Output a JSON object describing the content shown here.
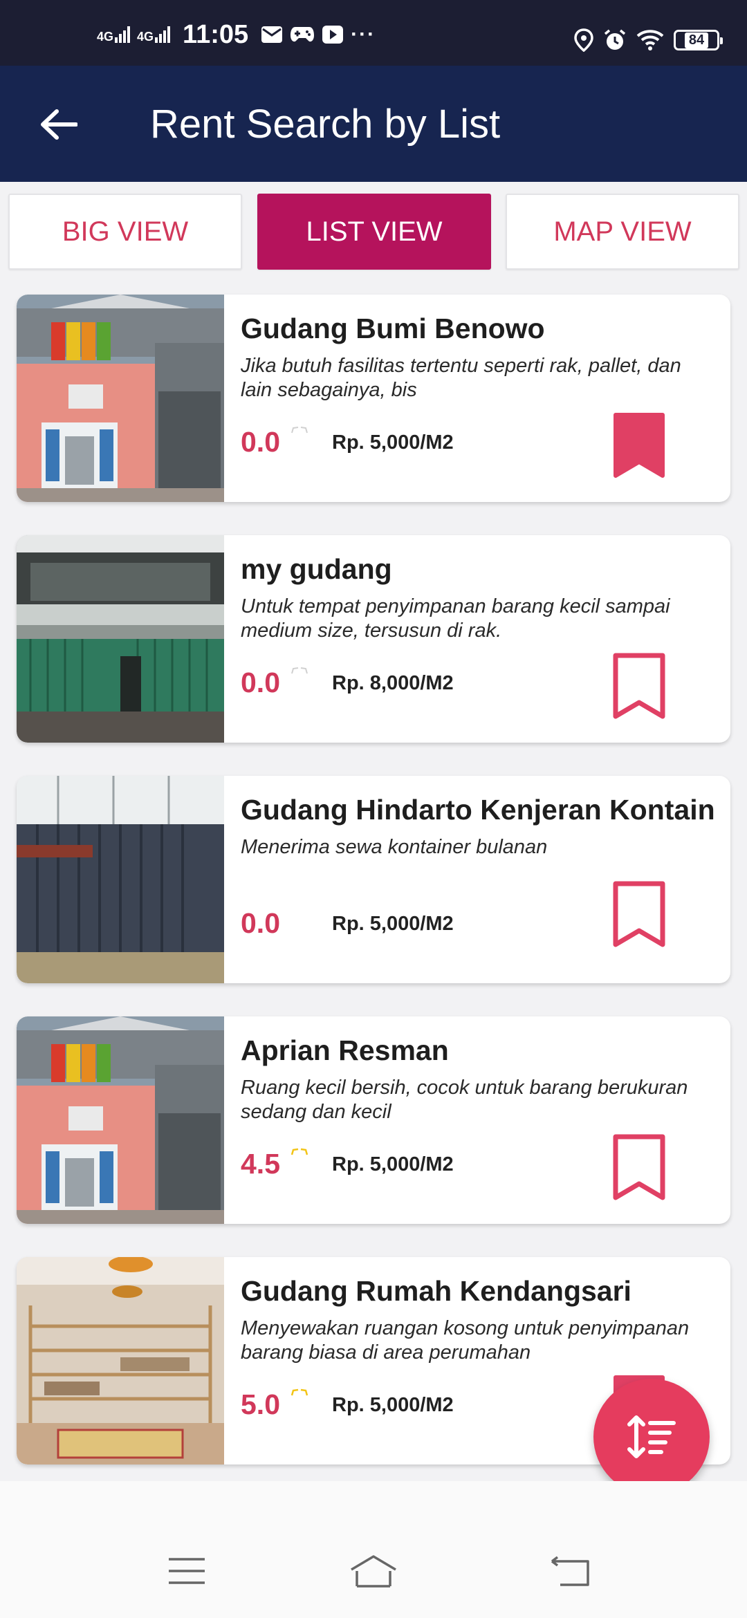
{
  "status_bar": {
    "time": "11:05",
    "network_1": "4G",
    "network_2": "4G",
    "more": "···",
    "battery": "84"
  },
  "header": {
    "title": "Rent Search by List"
  },
  "tabs": [
    {
      "label": "BIG VIEW",
      "active": false
    },
    {
      "label": "LIST VIEW",
      "active": true
    },
    {
      "label": "MAP VIEW",
      "active": false
    }
  ],
  "listings": [
    {
      "title": "Gudang Bumi Benowo",
      "description": "Jika butuh fasilitas tertentu seperti rak, pallet, dan lain sebagainya, bis",
      "rating": "0.0",
      "price": "Rp. 5,000/M2",
      "bookmarked": true,
      "image": "warehouse-flag-building"
    },
    {
      "title": "my gudang",
      "description": "Untuk tempat penyimpanan barang kecil sampai medium size, tersusun di rak.",
      "rating": "0.0",
      "price": "Rp. 8,000/M2",
      "bookmarked": false,
      "image": "green-shutter-building"
    },
    {
      "title": "Gudang Hindarto Kenjeran Kontain",
      "description": "Menerima sewa kontainer bulanan",
      "rating": "0.0",
      "price": "Rp. 5,000/M2",
      "bookmarked": false,
      "image": "container"
    },
    {
      "title": "Aprian Resman",
      "description": "Ruang kecil bersih, cocok untuk barang berukuran sedang dan kecil",
      "rating": "4.5",
      "price": "Rp. 5,000/M2",
      "bookmarked": false,
      "image": "warehouse-flag-building"
    },
    {
      "title": "Gudang Rumah Kendangsari",
      "description": "Menyewakan ruangan kosong untuk penyimpanan barang biasa di area perumahan",
      "rating": "5.0",
      "price": "Rp. 5,000/M2",
      "bookmarked": true,
      "image": "storage-room-shelves"
    }
  ],
  "colors": {
    "app_bar": "#172550",
    "accent": "#d1385a",
    "active_tab": "#b5135c",
    "fab": "#e53c5e",
    "star_empty": "#cfcfcf",
    "star_filled": "#f2c417"
  },
  "icons": {
    "back": "arrow-left-icon",
    "bookmark": "bookmark-icon",
    "fab": "sort-icon",
    "nav": [
      "menu-icon",
      "home-icon",
      "back-nav-icon"
    ]
  }
}
